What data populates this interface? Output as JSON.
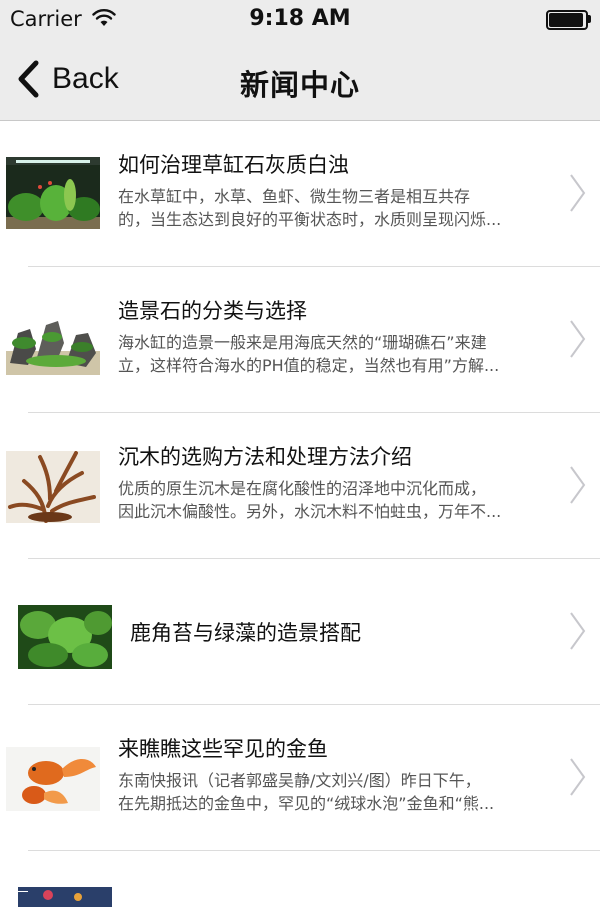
{
  "status_bar": {
    "carrier": "Carrier",
    "time": "9:18 AM",
    "wifi_icon": "wifi-icon",
    "battery_icon": "battery-icon"
  },
  "nav": {
    "back_label": "Back",
    "title": "新闻中心"
  },
  "news": [
    {
      "title": "如何治理草缸石灰质白浊",
      "desc_line1": "在水草缸中，水草、鱼虾、微生物三者是相互共存",
      "desc_line2": "的，当生态达到良好的平衡状态时，水质则呈现闪烁...",
      "thumbnail": "planted-aquarium"
    },
    {
      "title": "造景石的分类与选择",
      "desc_line1": "海水缸的造景一般来是用海底天然的“珊瑚礁石”来建",
      "desc_line2": "立，这样符合海水的PH值的稳定，当然也有用”方解...",
      "thumbnail": "aquascape-rocks"
    },
    {
      "title": "沉木的选购方法和处理方法介绍",
      "desc_line1": "优质的原生沉木是在腐化酸性的沼泽地中沉化而成，",
      "desc_line2": "因此沉木偏酸性。另外，水沉木料不怕蛀虫，万年不...",
      "thumbnail": "driftwood"
    },
    {
      "title": "鹿角苔与绿藻的造景搭配",
      "thumbnail": "riccia-moss"
    },
    {
      "title": "来瞧瞧这些罕见的金鱼",
      "desc_line1": "  东南快报讯（记者郭盛吴静/文刘兴/图）昨日下午，",
      "desc_line2": "在先期抵达的金鱼中，罕见的“绒球水泡”金鱼和“熊...",
      "thumbnail": "goldfish"
    }
  ],
  "colors": {
    "bar_background": "#ececec",
    "separator": "#dcdcdc",
    "chevron": "#c7c7cc",
    "text_primary": "#111111",
    "text_secondary": "#555555"
  }
}
